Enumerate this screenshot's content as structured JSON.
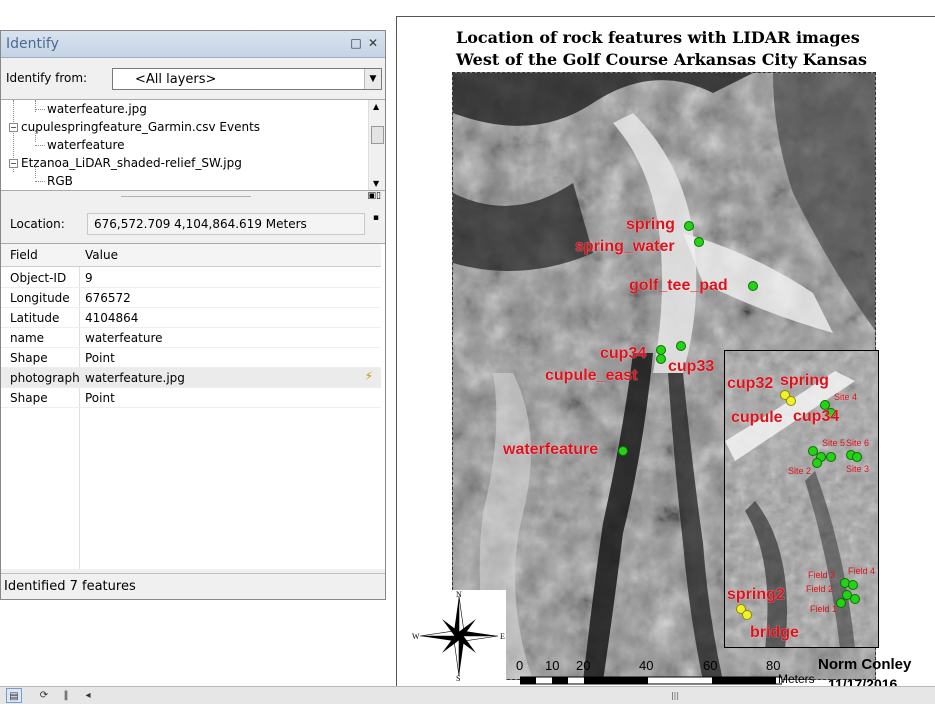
{
  "map_layout": {
    "title_line1": "Location of rock features with LIDAR images",
    "title_line2": "West of the Golf Course Arkansas City Kansas",
    "author": "Norm Conley",
    "date": "11/17/2016",
    "scale": {
      "ticks": [
        "0",
        "10",
        "20",
        "40",
        "60",
        "80"
      ],
      "units": "Meters"
    },
    "compass": {
      "n": "N",
      "s": "S",
      "e": "E",
      "w": "W"
    },
    "features": [
      {
        "label": "spring"
      },
      {
        "label": "spring_water"
      },
      {
        "label": "golf_tee_pad"
      },
      {
        "label": "cup34"
      },
      {
        "label": "cup33"
      },
      {
        "label": "cupule_east"
      },
      {
        "label": "waterfeature"
      }
    ],
    "inset": {
      "labels": [
        "cup32",
        "spring",
        "cupule",
        "cup34",
        "Site 4",
        "Site 5",
        "Site 6",
        "Site 3",
        "Site 2",
        "spring2",
        "bridge",
        "Field 4",
        "Field 3",
        "Field 2",
        "Field 1"
      ]
    },
    "colors": {
      "feature_dot": "#24d414",
      "label": "#e0101a",
      "other_dot": "#f2f22a"
    }
  },
  "identify": {
    "title": "Identify",
    "identify_from_label": "Identify from:",
    "identify_from_value": "<All layers>",
    "tree": [
      {
        "text": "waterfeature.jpg",
        "level": 1
      },
      {
        "text": "cupulespringfeature_Garmin.csv Events",
        "level": 0
      },
      {
        "text": "waterfeature",
        "level": 1
      },
      {
        "text": "Etzanoa_LiDAR_shaded-relief_SW.jpg",
        "level": 0
      },
      {
        "text": "RGB",
        "level": 1
      }
    ],
    "location_label": "Location:",
    "location_value": "676,572.709  4,104,864.619 Meters",
    "grid_headers": {
      "field": "Field",
      "value": "Value"
    },
    "rows": [
      {
        "field": "Object-ID",
        "value": "9"
      },
      {
        "field": "Longitude",
        "value": "676572"
      },
      {
        "field": "Latitude",
        "value": "4104864"
      },
      {
        "field": "name",
        "value": "waterfeature"
      },
      {
        "field": "Shape",
        "value": "Point"
      },
      {
        "field": "photograph",
        "value": "waterfeature.jpg"
      },
      {
        "field": "Shape",
        "value": "Point"
      }
    ],
    "status": "Identified 7 features"
  },
  "icons": {
    "restore": "restore-icon",
    "close": "close-icon",
    "dropdown": "chevron-down-icon",
    "hyperlink": "lightning-icon"
  }
}
